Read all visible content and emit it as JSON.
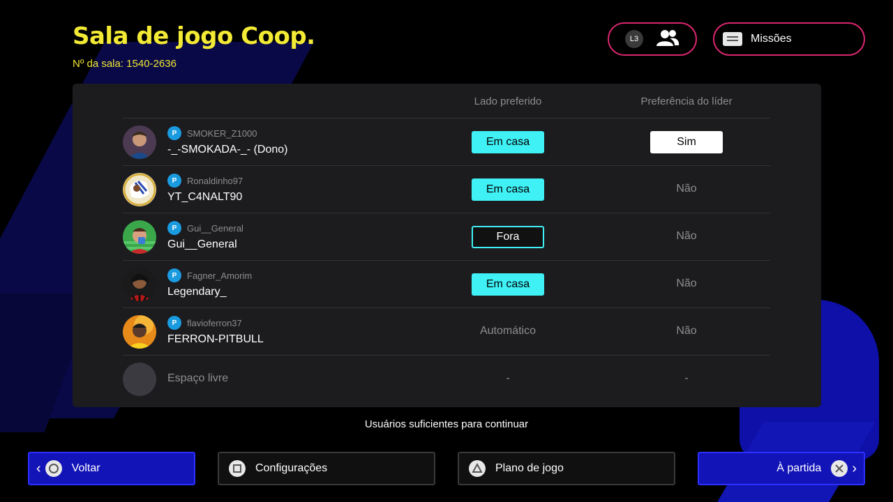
{
  "header": {
    "title": "Sala de jogo Coop.",
    "room_number": "Nº da sala: 1540-2636",
    "friends_button": {
      "l3_label": "L3",
      "icon": "friends-icon"
    },
    "missions_button": {
      "label": "Missões",
      "icon": "missions-icon"
    }
  },
  "table": {
    "columns": {
      "side": "Lado preferido",
      "leader": "Preferência do líder"
    },
    "rows": [
      {
        "psn_id": "SMOKER_Z1000",
        "name": "-_-SMOKADA-_- (Dono)",
        "side": "Em casa",
        "side_style": "home",
        "leader": "Sim",
        "leader_style": "pill"
      },
      {
        "psn_id": "Ronaldinho97",
        "name": "YT_C4NALT90",
        "side": "Em casa",
        "side_style": "home",
        "leader": "Não",
        "leader_style": "text"
      },
      {
        "psn_id": "Gui__General",
        "name": "Gui__General",
        "side": "Fora",
        "side_style": "away",
        "leader": "Não",
        "leader_style": "text"
      },
      {
        "psn_id": "Fagner_Amorim",
        "name": "Legendary_",
        "side": "Em casa",
        "side_style": "home",
        "leader": "Não",
        "leader_style": "text"
      },
      {
        "psn_id": "flavioferron37",
        "name": "FERRON-PITBULL",
        "side": "Automático",
        "side_style": "text",
        "leader": "Não",
        "leader_style": "text"
      }
    ],
    "free_slot": {
      "label": "Espaço livre",
      "side": "-",
      "leader": "-"
    }
  },
  "status_text": "Usuários suficientes para continuar",
  "footer": {
    "back": {
      "label": "Voltar",
      "glyph": "circle-button-icon"
    },
    "settings": {
      "label": "Configurações",
      "glyph": "square-button-icon"
    },
    "game_plan": {
      "label": "Plano de jogo",
      "glyph": "triangle-button-icon"
    },
    "to_match": {
      "label": "À partida",
      "glyph": "cross-button-icon"
    }
  },
  "colors": {
    "title_yellow": "#f2ea34",
    "accent_cyan": "#3ff0f5",
    "header_border_pink": "#d8266e",
    "footer_blue": "#1214b8",
    "panel_bg": "#1c1c1f"
  }
}
